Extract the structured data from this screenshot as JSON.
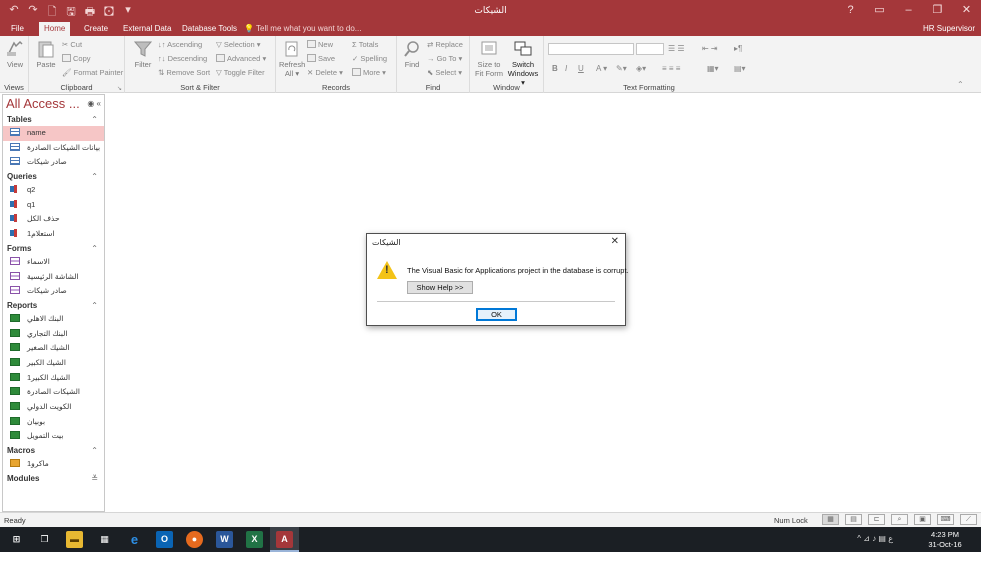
{
  "window": {
    "title": "الشيكات",
    "minimize": "‒",
    "restore": "❐",
    "close": "✕",
    "help": "?"
  },
  "quick_access": [
    "↶",
    "↷",
    "🗋",
    "🖫",
    "🖶",
    "🖸",
    "▾"
  ],
  "tabs": [
    {
      "label": "File",
      "active": false
    },
    {
      "label": "Home",
      "active": true
    },
    {
      "label": "Create",
      "active": false
    },
    {
      "label": "External Data",
      "active": false
    },
    {
      "label": "Database Tools",
      "active": false
    }
  ],
  "tell_me": "Tell me what you want to do...",
  "user": "HR Supervisor",
  "ribbon": {
    "views": {
      "group": "Views",
      "view": "View"
    },
    "clipboard": {
      "group": "Clipboard",
      "paste": "Paste",
      "cut": "Cut",
      "copy": "Copy",
      "format_painter": "Format Painter"
    },
    "sort_filter": {
      "group": "Sort & Filter",
      "filter": "Filter",
      "ascending": "Ascending",
      "descending": "Descending",
      "remove_sort": "Remove Sort",
      "selection": "Selection ▾",
      "advanced": "Advanced ▾",
      "toggle_filter": "Toggle Filter"
    },
    "records": {
      "group": "Records",
      "refresh": "Refresh",
      "refresh_all": "All ▾",
      "new": "New",
      "save": "Save",
      "delete": "Delete ▾",
      "totals": "Totals",
      "spelling": "Spelling",
      "more": "More ▾"
    },
    "find": {
      "group": "Find",
      "find": "Find",
      "replace": "Replace",
      "goto": "Go To ▾",
      "select": "Select ▾"
    },
    "window": {
      "group": "Window",
      "size_to_fit": "Size to",
      "size_to_fit2": "Fit Form",
      "switch": "Switch",
      "switch2": "Windows ▾"
    },
    "text_formatting": {
      "group": "Text Formatting",
      "bold": "B",
      "italic": "I",
      "underline": "U",
      "font_color": "A ▾"
    }
  },
  "nav": {
    "title": "All Access ...",
    "sections": [
      {
        "name": "Tables",
        "items": [
          {
            "label": "name",
            "type": "table",
            "selected": true
          },
          {
            "label": "بيانات الشيكات الصادرة",
            "type": "table"
          },
          {
            "label": "صادر شيكات",
            "type": "table"
          }
        ]
      },
      {
        "name": "Queries",
        "items": [
          {
            "label": "q2",
            "type": "query"
          },
          {
            "label": "q1",
            "type": "query"
          },
          {
            "label": "حذف الكل",
            "type": "query"
          },
          {
            "label": "استعلام1",
            "type": "query"
          }
        ]
      },
      {
        "name": "Forms",
        "items": [
          {
            "label": "الاسماء",
            "type": "form"
          },
          {
            "label": "الشاشة الرئيسية",
            "type": "form"
          },
          {
            "label": "صادر شيكات",
            "type": "form"
          }
        ]
      },
      {
        "name": "Reports",
        "items": [
          {
            "label": "البنك الاهلي",
            "type": "report"
          },
          {
            "label": "البنك التجاري",
            "type": "report"
          },
          {
            "label": "الشيك الصغير",
            "type": "report"
          },
          {
            "label": "الشيك الكبير",
            "type": "report"
          },
          {
            "label": "الشيك الكبير1",
            "type": "report"
          },
          {
            "label": "الشيكات الصادرة",
            "type": "report"
          },
          {
            "label": "الكويت الدولي",
            "type": "report"
          },
          {
            "label": "بوبيان",
            "type": "report"
          },
          {
            "label": "بيت التمويل",
            "type": "report"
          }
        ]
      },
      {
        "name": "Macros",
        "items": [
          {
            "label": "ماكرو1",
            "type": "macro"
          }
        ]
      },
      {
        "name": "Modules",
        "items": [],
        "collapsed": true
      }
    ]
  },
  "dialog": {
    "title": "الشيكات",
    "message": "The Visual Basic for Applications project in the database is corrupt.",
    "help_button": "Show Help >>",
    "ok_button": "OK",
    "close": "✕",
    "icon": "warning-icon"
  },
  "status": {
    "text": "Ready",
    "num_lock": "Num Lock"
  },
  "taskbar": {
    "time": "4:23 PM",
    "date": "31-Oct-16",
    "lang": "ع"
  },
  "colors": {
    "accent": "#a4373a",
    "selected_item": "#f6c6c6",
    "taskbar": "#1b1f24"
  }
}
